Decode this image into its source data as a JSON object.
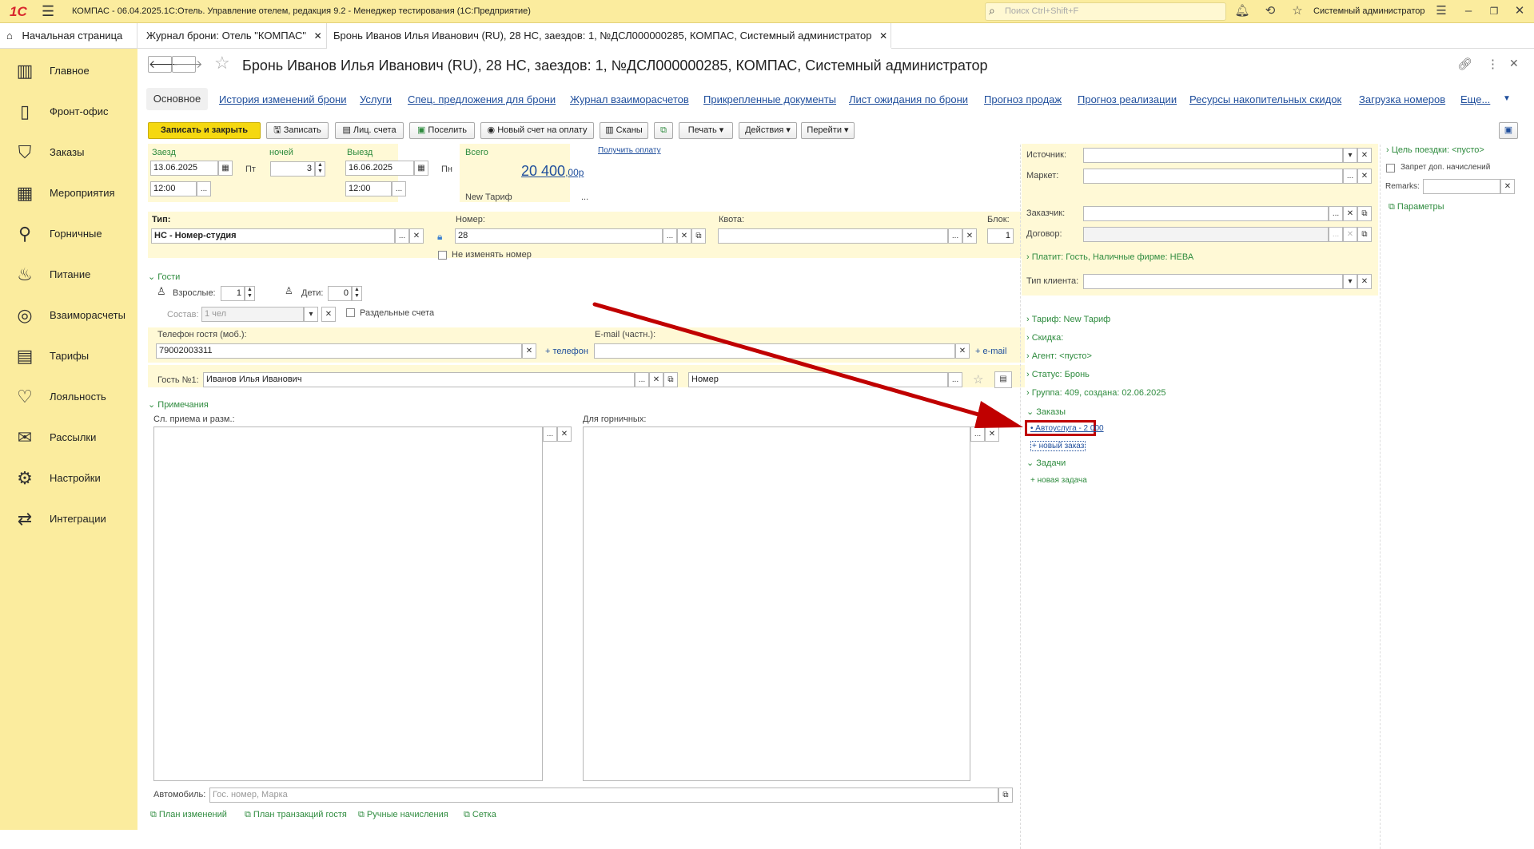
{
  "app": {
    "window_title": "КОМПАС - 06.04.2025.1С:Отель. Управление отелем, редакция 9.2 - Менеджер тестирования (1С:Предприятие)",
    "logo": "1С",
    "search_placeholder": "Поиск Ctrl+Shift+F",
    "user": "Системный администратор"
  },
  "tabs": [
    {
      "label": "Начальная страница"
    },
    {
      "label": "Журнал брони: Отель \"КОМПАС\""
    },
    {
      "label": "Бронь Иванов Илья Иванович (RU), 28 НС, заездов: 1, №ДСЛ000000285, КОМПАС, Системный администратор"
    }
  ],
  "sidebar": {
    "items": [
      {
        "label": "Главное",
        "icon": "bar-chart-icon"
      },
      {
        "label": "Фронт-офис",
        "icon": "door-icon"
      },
      {
        "label": "Заказы",
        "icon": "bag-icon"
      },
      {
        "label": "Мероприятия",
        "icon": "calendar-icon"
      },
      {
        "label": "Горничные",
        "icon": "vacuum-icon"
      },
      {
        "label": "Питание",
        "icon": "food-icon"
      },
      {
        "label": "Взаиморасчеты",
        "icon": "money-icon"
      },
      {
        "label": "Тарифы",
        "icon": "tariff-icon"
      },
      {
        "label": "Лояльность",
        "icon": "heart-icon"
      },
      {
        "label": "Рассылки",
        "icon": "mail-icon"
      },
      {
        "label": "Настройки",
        "icon": "gear-icon"
      },
      {
        "label": "Интеграции",
        "icon": "integration-icon"
      }
    ]
  },
  "form": {
    "title": "Бронь Иванов Илья Иванович (RU), 28 НС, заездов: 1, №ДСЛ000000285, КОМПАС, Системный администратор",
    "nav": [
      "Основное",
      "История изменений брони",
      "Услуги",
      "Спец. предложения для брони",
      "Журнал взаиморасчетов",
      "Прикрепленные документы",
      "Лист ожидания по брони",
      "Прогноз продаж",
      "Прогноз реализации",
      "Ресурсы накопительных скидок",
      "Загрузка номеров",
      "Еще..."
    ],
    "toolbar": {
      "save_close": "Записать и закрыть",
      "save": "Записать",
      "accounts": "Лиц. счета",
      "checkin": "Поселить",
      "new_invoice": "Новый счет на оплату",
      "scans": "Сканы",
      "print": "Печать",
      "actions": "Действия",
      "goto": "Перейти"
    },
    "dates": {
      "arrival_label": "Заезд",
      "arrival_date": "13.06.2025",
      "arrival_dow": "Пт",
      "arrival_time": "12:00",
      "nights_label": "ночей",
      "nights": "3",
      "departure_label": "Выезд",
      "departure_date": "16.06.2025",
      "departure_dow": "Пн",
      "departure_time": "12:00",
      "total_label": "Всего",
      "total_main": "20 400",
      "total_cents": ",00р",
      "tariff": "New Тариф",
      "get_payment": "Получить оплату"
    },
    "room": {
      "type_label": "Тип:",
      "type_value": "НС - Номер-студия",
      "number_label": "Номер:",
      "number_value": "28",
      "quota_label": "Квота:",
      "block_label": "Блок:",
      "block_value": "1",
      "no_change": "Не изменять номер"
    },
    "guests": {
      "section": "Гости",
      "adults_label": "Взрослые:",
      "adults": "1",
      "children_label": "Дети:",
      "children": "0",
      "composition_label": "Состав:",
      "composition_value": "1 чел",
      "separate_accounts": "Раздельные счета",
      "phone_label": "Телефон гостя (моб.):",
      "phone_value": "79002003311",
      "add_phone": "+ телефон",
      "email_label": "E-mail (частн.):",
      "add_email": "+ e-mail",
      "guest_label": "Гость №1:",
      "guest_value": "Иванов Илья Иванович",
      "room_placeholder": "Номер"
    },
    "notes": {
      "section": "Примечания",
      "reception_label": "Сл. приема и разм.:",
      "maids_label": "Для горничных:",
      "car_label": "Автомобиль:",
      "car_placeholder": "Гос. номер, Марка"
    },
    "footer_links": [
      "План изменений",
      "План транзакций гостя",
      "Ручные начисления",
      "Сетка"
    ],
    "right": {
      "source_label": "Источник:",
      "market_label": "Маркет:",
      "customer_label": "Заказчик:",
      "contract_label": "Договор:",
      "payer": "Платит: Гость, Наличные фирме: НЕВА",
      "client_type_label": "Тип клиента:",
      "tariff": "Тариф: New Тариф",
      "discount": "Скидка:",
      "agent": "Агент: <пусто>",
      "status": "Статус: Бронь",
      "group": "Группа: 409, создана: 02.06.2025",
      "orders_section": "Заказы",
      "order_item": "• Автоуслуга - 2 000",
      "new_order": "+ новый заказ",
      "tasks_section": "Задачи",
      "new_task": "+ новая задача"
    },
    "far_right": {
      "trip_purpose": "Цель поездки: <пусто>",
      "no_extra": "Запрет доп. начислений",
      "remarks_label": "Remarks:",
      "params": "Параметры"
    }
  },
  "colors": {
    "accent_yellow": "#fbec9e",
    "link_blue": "#1f4e9c",
    "green": "#2e8b3e",
    "arrow_red": "#c00000"
  }
}
